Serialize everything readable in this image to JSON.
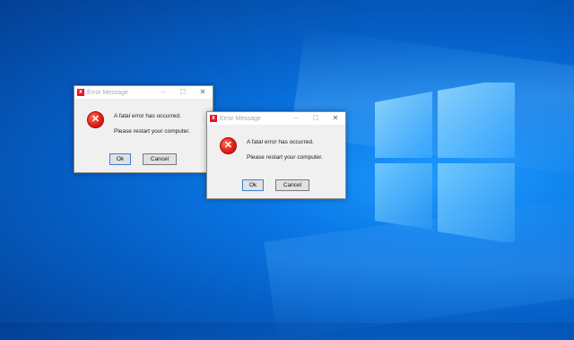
{
  "dialogs": [
    {
      "title": "Error Message",
      "message_line1": "A fatal error has occurred.",
      "message_line2": "Please restart your computer.",
      "ok_label": "Ok",
      "cancel_label": "Cancel",
      "icon": "error-icon"
    },
    {
      "title": "Error Message",
      "message_line1": "A fatal error has occurred.",
      "message_line2": "Please restart your computer.",
      "ok_label": "Ok",
      "cancel_label": "Cancel",
      "icon": "error-icon"
    }
  ],
  "controls": {
    "minimize": "–",
    "maximize": "☐",
    "close": "✕",
    "error_glyph": "✕",
    "title_glyph": "x"
  },
  "colors": {
    "error_red": "#e1221a",
    "desktop_blue": "#0a78e6",
    "title_text": "#a9a9a9"
  }
}
